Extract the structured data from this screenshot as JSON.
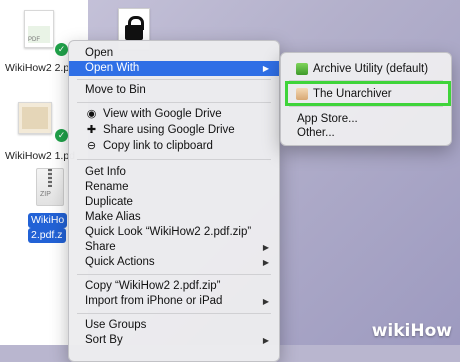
{
  "files": [
    {
      "label": "WikiHow2 2.pdf"
    },
    {
      "label": "WikiHow2 1.pd"
    },
    {
      "label_line1": "WikiHo",
      "label_line2": "2.pdf.z"
    }
  ],
  "zip_text": "ZIP",
  "file_badge": "PDF",
  "check_glyph": "✓",
  "menu": {
    "items": [
      {
        "label": "Open"
      },
      {
        "label": "Open With",
        "submenu": true,
        "highlighted": true
      },
      {
        "label": "Move to Bin"
      },
      {
        "label": "View with Google Drive",
        "icon": "eye-icon"
      },
      {
        "label": "Share using Google Drive",
        "icon": "person-add-icon"
      },
      {
        "label": "Copy link to clipboard",
        "icon": "link-icon"
      },
      {
        "label": "Get Info"
      },
      {
        "label": "Rename"
      },
      {
        "label": "Duplicate"
      },
      {
        "label": "Make Alias"
      },
      {
        "label": "Quick Look “WikiHow2 2.pdf.zip”"
      },
      {
        "label": "Share",
        "submenu": true
      },
      {
        "label": "Quick Actions",
        "submenu": true
      },
      {
        "label": "Copy “WikiHow2 2.pdf.zip”"
      },
      {
        "label": "Import from iPhone or iPad",
        "submenu": true
      },
      {
        "label": "Use Groups"
      },
      {
        "label": "Sort By",
        "submenu": true
      }
    ]
  },
  "submenu": {
    "items": [
      {
        "label": "Archive Utility (default)",
        "icon": "archive-utility-icon"
      },
      {
        "label": "The Unarchiver",
        "icon": "unarchiver-icon"
      },
      {
        "label": "App Store..."
      },
      {
        "label": "Other..."
      }
    ]
  },
  "watermark": "wikiHow",
  "colors": {
    "highlight": "#2f6fe6",
    "callout": "#3fd43a"
  }
}
